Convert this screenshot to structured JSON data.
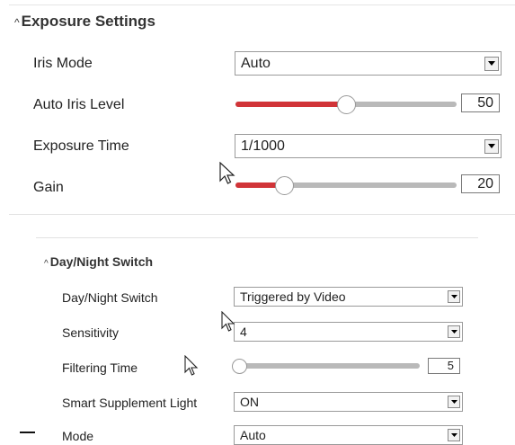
{
  "exposure": {
    "title": "Exposure Settings",
    "iris_mode": {
      "label": "Iris Mode",
      "value": "Auto"
    },
    "auto_iris_level": {
      "label": "Auto Iris Level",
      "value": "50",
      "level_percent": 50
    },
    "exposure_time": {
      "label": "Exposure Time",
      "value": "1/1000"
    },
    "gain": {
      "label": "Gain",
      "value": "20",
      "level_percent": 20
    }
  },
  "daynight": {
    "title": "Day/Night Switch",
    "switch": {
      "label": "Day/Night Switch",
      "value": "Triggered by Video"
    },
    "sensitivity": {
      "label": "Sensitivity",
      "value": "4"
    },
    "filtering_time": {
      "label": "Filtering Time",
      "value": "5",
      "level_percent": 5
    },
    "smart_supplement_light": {
      "label": "Smart Supplement Light",
      "value": "ON"
    },
    "mode": {
      "label": "Mode",
      "value": "Auto"
    }
  },
  "icons": {
    "collapse": "chevron-up-icon",
    "dropdown": "dropdown-arrow-icon",
    "cursor": "mouse-pointer-icon"
  },
  "colors": {
    "slider_fill": "#d13438",
    "slider_track": "#b9b9b9"
  }
}
